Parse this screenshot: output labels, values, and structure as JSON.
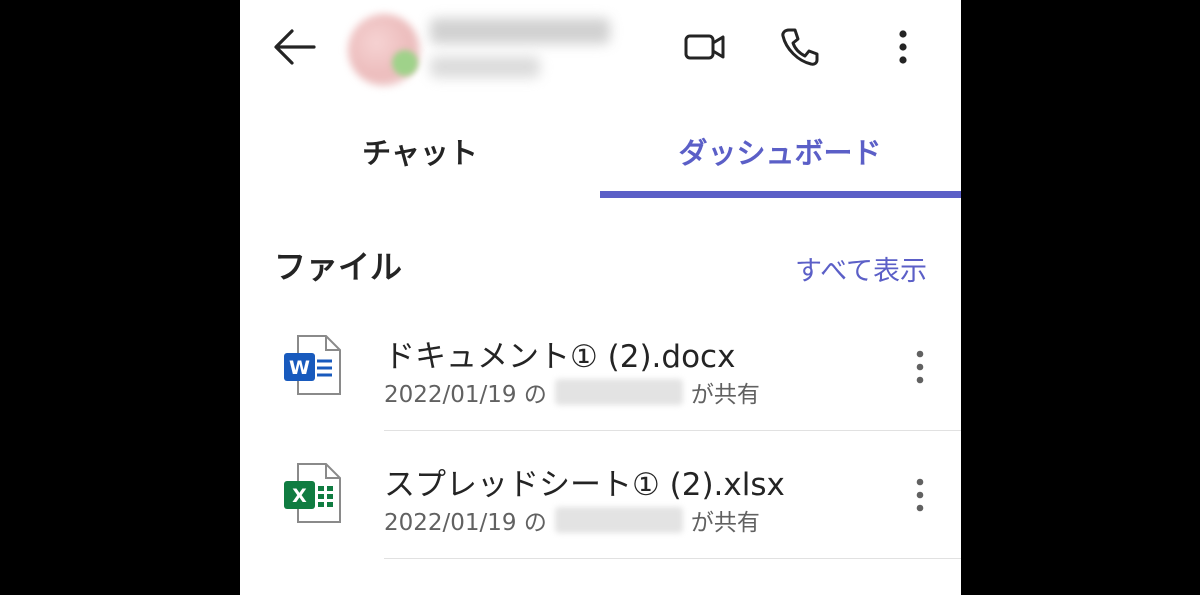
{
  "header": {
    "back_icon": "arrow-left-icon",
    "actions": [
      "video-call-icon",
      "phone-icon",
      "more-vertical-icon"
    ]
  },
  "tabs": [
    {
      "label": "チャット",
      "active": false
    },
    {
      "label": "ダッシュボード",
      "active": true
    }
  ],
  "files_section": {
    "title": "ファイル",
    "see_all": "すべて表示",
    "items": [
      {
        "name": "ドキュメント① (2).docx",
        "date": "2022/01/19 の",
        "shared_suffix": "が共有",
        "icon": "word-file-icon"
      },
      {
        "name": "スプレッドシート① (2).xlsx",
        "date": "2022/01/19 の",
        "shared_suffix": "が共有",
        "icon": "excel-file-icon"
      }
    ]
  },
  "colors": {
    "accent": "#5b5fc7",
    "word": "#185abd",
    "excel": "#107c41",
    "text": "#242424",
    "secondary_text": "#616161"
  }
}
